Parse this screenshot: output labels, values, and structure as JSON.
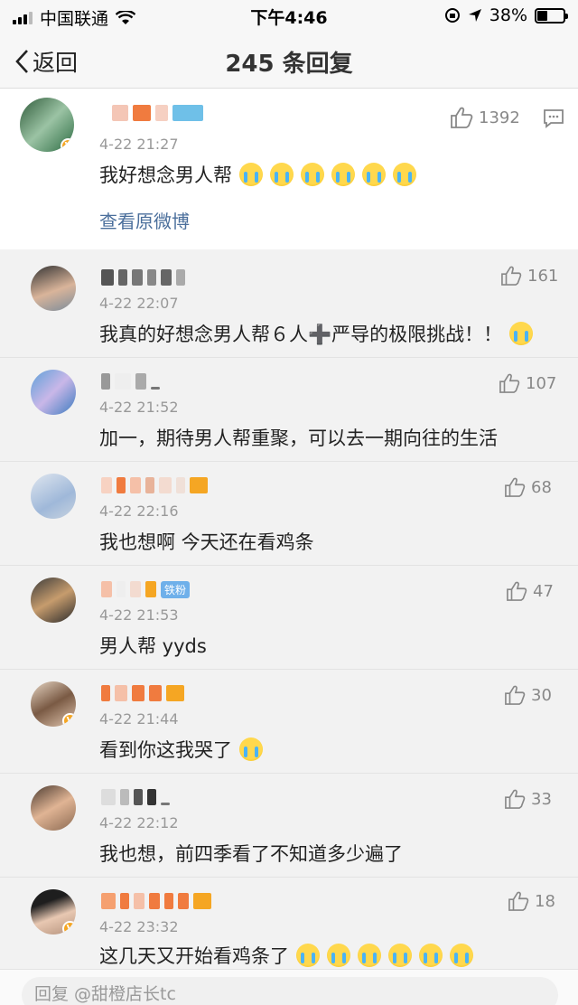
{
  "status_bar": {
    "carrier": "中国联通",
    "time": "下午4:46",
    "battery": "38%",
    "battery_level": 0.38
  },
  "nav": {
    "back_label": "返回",
    "title": "245 条回复"
  },
  "original_post": {
    "time": "4-22 21:27",
    "text": "我好想念男人帮",
    "emoji_count": 6,
    "likes": "1392",
    "view_original": "查看原微博"
  },
  "replies": [
    {
      "time": "4-22 22:07",
      "text": "我真的好想念男人帮６人➕严导的极限挑战！！",
      "emoji_count": 1,
      "likes": "161",
      "verified": false
    },
    {
      "time": "4-22 21:52",
      "text": "加一，期待男人帮重聚，可以去一期向往的生活",
      "emoji_count": 0,
      "likes": "107",
      "verified": false
    },
    {
      "time": "4-22 22:16",
      "text": "我也想啊 今天还在看鸡条",
      "emoji_count": 0,
      "likes": "68",
      "verified": false
    },
    {
      "time": "4-22 21:53",
      "text": "男人帮 yyds",
      "emoji_count": 0,
      "likes": "47",
      "verified": false,
      "badge": "铁粉"
    },
    {
      "time": "4-22 21:44",
      "text": "看到你这我哭了",
      "emoji_count": 1,
      "likes": "30",
      "verified": true
    },
    {
      "time": "4-22 22:12",
      "text": "我也想，前四季看了不知道多少遍了",
      "emoji_count": 0,
      "likes": "33",
      "verified": false
    },
    {
      "time": "4-22 23:32",
      "text": "这几天又开始看鸡条了",
      "emoji_count": 6,
      "likes": "18",
      "verified": true
    }
  ],
  "reply_input": {
    "placeholder": "回复 @甜橙店长tc"
  },
  "colors": {
    "link": "#4b6f9c",
    "verified": "#f5a623",
    "cry_emoji": "#ffd84d"
  }
}
